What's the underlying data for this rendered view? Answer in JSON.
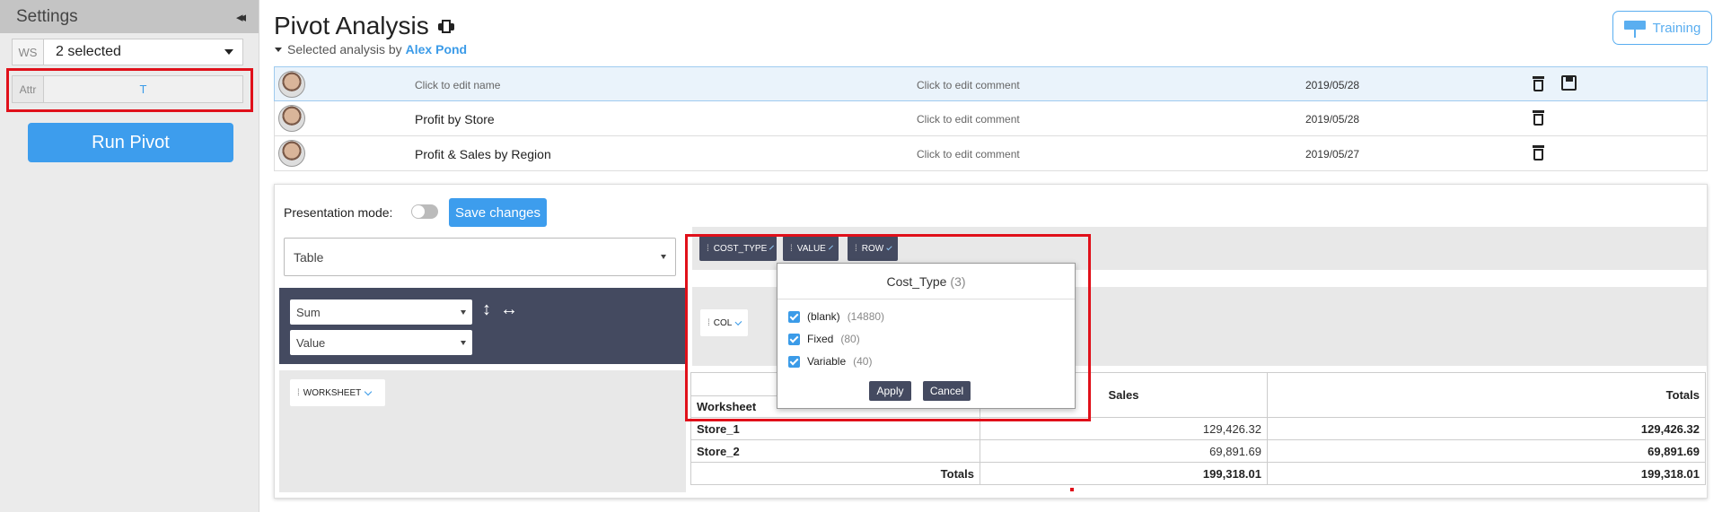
{
  "sidebar": {
    "title": "Settings",
    "collapse_glyph": "◂◂",
    "ws_tag": "WS",
    "ws_value": "2 selected",
    "attr_tag": "Attr",
    "attr_value": "T",
    "run_label": "Run Pivot"
  },
  "header": {
    "title": "Pivot Analysis",
    "subtitle_prefix": "Selected analysis by",
    "author": "Alex Pond",
    "training_label": "Training"
  },
  "analyses": [
    {
      "name": "Click to edit name",
      "comment": "Click to edit comment",
      "date": "2019/05/28"
    },
    {
      "name": "Profit by Store",
      "comment": "Click to edit comment",
      "date": "2019/05/28"
    },
    {
      "name": "Profit & Sales by Region",
      "comment": "Click to edit comment",
      "date": "2019/05/27"
    }
  ],
  "pivot": {
    "presentation_label": "Presentation mode:",
    "save_changes_label": "Save changes",
    "renderer": "Table",
    "aggregator": "Sum",
    "agg_field": "Value",
    "sort_v_glyph": "↕",
    "sort_h_glyph": "↔",
    "row_field": "WORKSHEET",
    "col_field": "COL",
    "unused_fields": [
      "COST_TYPE",
      "VALUE",
      "ROW"
    ]
  },
  "table": {
    "corner_header": "Worksheet",
    "col_header": "Sales",
    "totals_header": "Totals",
    "rows": [
      {
        "label": "Store_1",
        "value": "129,426.32",
        "total": "129,426.32"
      },
      {
        "label": "Store_2",
        "value": "69,891.69",
        "total": "69,891.69"
      }
    ],
    "grand_label": "Totals",
    "grand_value": "199,318.01",
    "grand_total": "199,318.01"
  },
  "popup": {
    "title": "Cost_Type",
    "count": "(3)",
    "options": [
      {
        "label": "(blank)",
        "count": "(14880)"
      },
      {
        "label": "Fixed",
        "count": "(80)"
      },
      {
        "label": "Variable",
        "count": "(40)"
      }
    ],
    "apply_label": "Apply",
    "cancel_label": "Cancel"
  },
  "colors": {
    "accent": "#3d9ded",
    "dark_pill": "#444a60",
    "highlight": "#e0101a"
  }
}
